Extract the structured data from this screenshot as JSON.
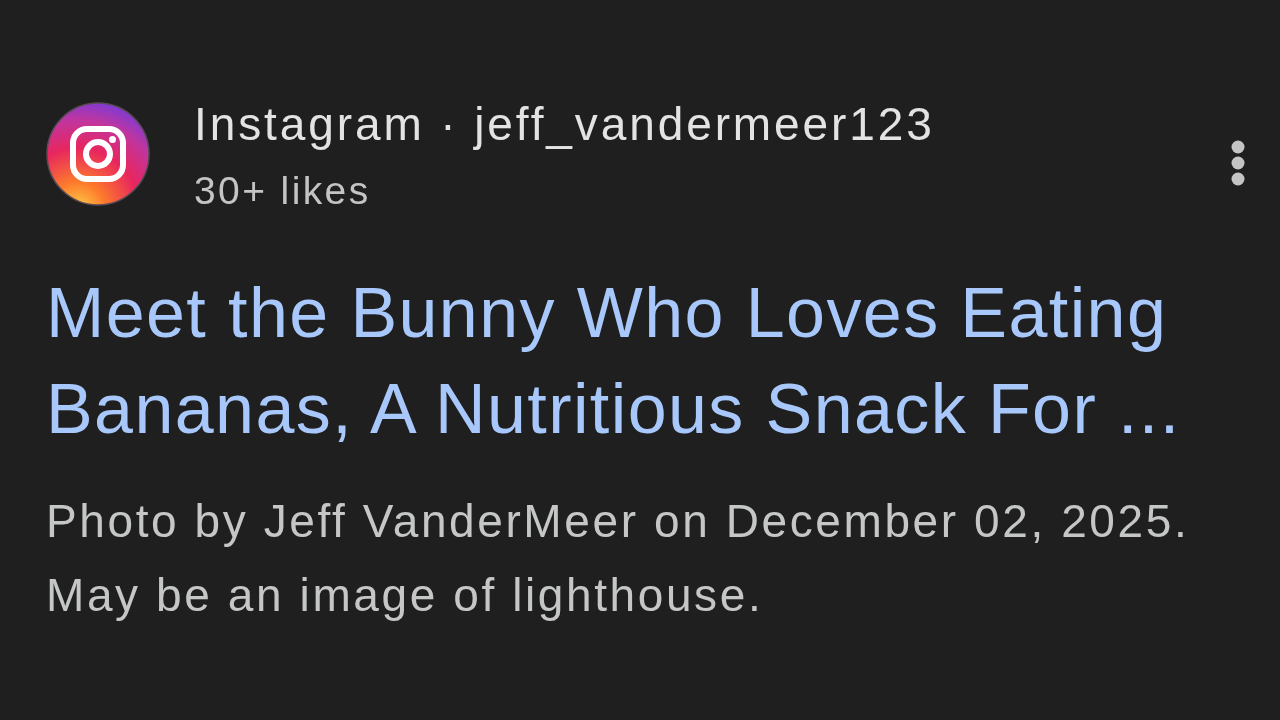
{
  "post": {
    "source": "Instagram · jeff_vandermeer123",
    "likes": "30+ likes",
    "title": "Meet the Bunny Who Loves Eating Bananas, A Nutritious Snack For ...",
    "description": "Photo by Jeff VanderMeer on December 02, 2025. May be an image of lighthouse."
  }
}
